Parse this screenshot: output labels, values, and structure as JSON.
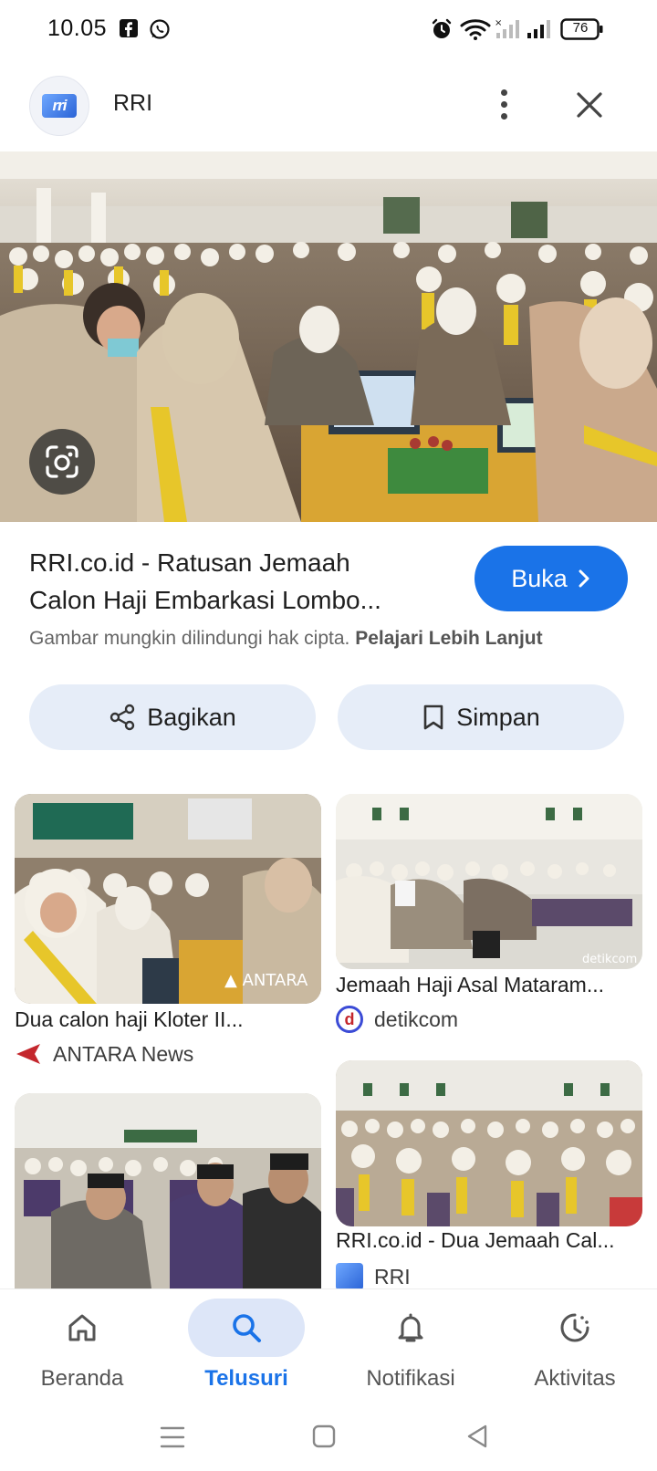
{
  "status_bar": {
    "time": "10.05",
    "battery": "76",
    "icons": [
      "facebook-icon",
      "whatsapp-icon",
      "alarm-icon",
      "wifi-icon",
      "signal-icon"
    ]
  },
  "header": {
    "avatar_text": "rri",
    "title": "RRI"
  },
  "result": {
    "title_line1": "RRI.co.id - Ratusan Jemaah",
    "title_line2": "Calon Haji Embarkasi Lombo...",
    "open_label": "Buka",
    "copyright_text": "Gambar mungkin dilindungi hak cipta.",
    "learn_more": "Pelajari Lebih Lanjut"
  },
  "actions": {
    "share_label": "Bagikan",
    "save_label": "Simpan"
  },
  "related": [
    {
      "title": "Dua calon haji Kloter II...",
      "source": "ANTARA News",
      "watermark": "ANTARA"
    },
    {
      "title": "Jemaah Haji Asal Mataram...",
      "source": "detikcom",
      "watermark": "detikcom"
    },
    {
      "title": "",
      "source": ""
    },
    {
      "title": "RRI.co.id - Dua Jemaah Cal...",
      "source": "RRI"
    }
  ],
  "bottom_nav": [
    {
      "label": "Beranda",
      "active": false
    },
    {
      "label": "Telusuri",
      "active": true
    },
    {
      "label": "Notifikasi",
      "active": false
    },
    {
      "label": "Aktivitas",
      "active": false
    }
  ],
  "colors": {
    "accent": "#1a73e8",
    "pill": "#e6edf8",
    "active_nav": "#dde6f8"
  }
}
